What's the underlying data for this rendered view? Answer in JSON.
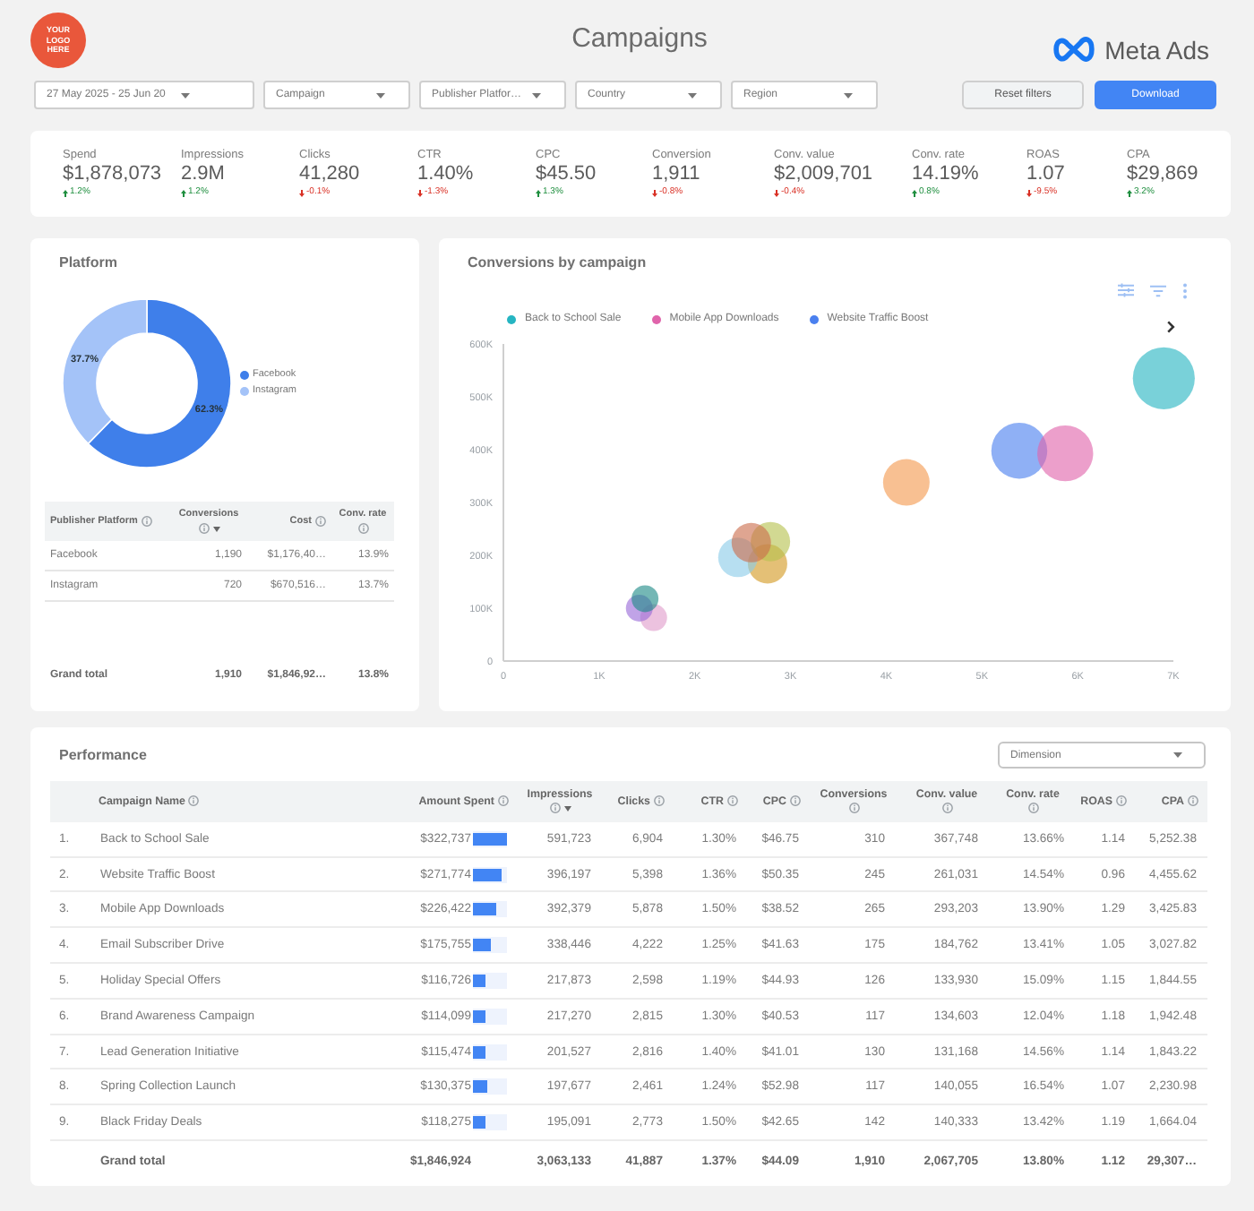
{
  "header": {
    "logo_text": "YOUR LOGO HERE",
    "title": "Campaigns",
    "brand": "Meta Ads"
  },
  "filters": [
    {
      "label": "27 May 2025 - 25 Jun 20"
    },
    {
      "label": "Campaign"
    },
    {
      "label": "Publisher Platfor…"
    },
    {
      "label": "Country"
    },
    {
      "label": "Region"
    }
  ],
  "buttons": [
    {
      "label": "Reset filters",
      "primary": false
    },
    {
      "label": "Download",
      "primary": true
    }
  ],
  "kpis": [
    {
      "label": "Spend",
      "value": "$1,878,073",
      "change": "1.2%",
      "up": true
    },
    {
      "label": "Impressions",
      "value": "2.9M",
      "change": "1.2%",
      "up": true
    },
    {
      "label": "Clicks",
      "value": "41,280",
      "change": "-0.1%",
      "up": false
    },
    {
      "label": "CTR",
      "value": "1.40%",
      "change": "-1.3%",
      "up": false
    },
    {
      "label": "CPC",
      "value": "$45.50",
      "change": "1.3%",
      "up": true
    },
    {
      "label": "Conversion",
      "value": "1,911",
      "change": "-0.8%",
      "up": false
    },
    {
      "label": "Conv. value",
      "value": "$2,009,701",
      "change": "-0.4%",
      "up": false
    },
    {
      "label": "Conv. rate",
      "value": "14.19%",
      "change": "0.8%",
      "up": true
    },
    {
      "label": "ROAS",
      "value": "1.07",
      "change": "-9.5%",
      "up": false
    },
    {
      "label": "CPA",
      "value": "$29,869",
      "change": "3.2%",
      "up": true
    }
  ],
  "platform": {
    "title": "Platform",
    "chart_data": {
      "type": "donut",
      "categories": [
        "Facebook",
        "Instagram"
      ],
      "values": [
        62.3,
        37.7
      ],
      "colors": [
        "#3f7fea",
        "#a4c3f8"
      ],
      "value_labels": [
        "62.3%",
        "37.7%"
      ]
    },
    "table": {
      "columns": [
        {
          "label": "Publisher Platform",
          "kind": "text",
          "help": true,
          "sorted": false
        },
        {
          "label": "Conversions",
          "kind": "number",
          "help": true,
          "sorted": true
        },
        {
          "label": "Cost",
          "kind": "number",
          "help": true,
          "sorted": false
        },
        {
          "label": "Conv. rate",
          "kind": "number",
          "help": true,
          "sorted": false
        }
      ],
      "rows": [
        {
          "cells": [
            "Facebook",
            "1,190",
            "$1,176,40…",
            "13.9%"
          ]
        },
        {
          "cells": [
            "Instagram",
            "720",
            "$670,516…",
            "13.7%"
          ]
        }
      ],
      "total": {
        "cells": [
          "Grand total",
          "1,910",
          "$1,846,92…",
          "13.8%"
        ]
      }
    }
  },
  "conversions_chart": {
    "title": "Conversions by campaign",
    "chart_data": {
      "type": "scatter",
      "xlim": [
        0,
        7000
      ],
      "ylim": [
        0,
        600000
      ],
      "xticks": [
        {
          "value": 0,
          "label": "0"
        },
        {
          "value": 1000,
          "label": "1K"
        },
        {
          "value": 2000,
          "label": "2K"
        },
        {
          "value": 3000,
          "label": "3K"
        },
        {
          "value": 4000,
          "label": "4K"
        },
        {
          "value": 5000,
          "label": "5K"
        },
        {
          "value": 6000,
          "label": "6K"
        },
        {
          "value": 7000,
          "label": "7K"
        }
      ],
      "yticks": [
        {
          "value": 0,
          "label": "0"
        },
        {
          "value": 100000,
          "label": "100K"
        },
        {
          "value": 200000,
          "label": "200K"
        },
        {
          "value": 300000,
          "label": "300K"
        },
        {
          "value": 400000,
          "label": "400K"
        },
        {
          "value": 500000,
          "label": "500K"
        },
        {
          "value": 600000,
          "label": "600K"
        }
      ],
      "series": [
        {
          "name": "Back to School Sale",
          "color": "#26b5c2",
          "x": [
            6900
          ],
          "values": [
            535000
          ]
        },
        {
          "name": "Mobile App Downloads",
          "color": "#e064ab",
          "x": [
            5870
          ],
          "values": [
            393000
          ]
        },
        {
          "name": "Website Traffic Boost",
          "color": "#4a80ef",
          "x": [
            5390
          ],
          "values": [
            398000
          ]
        },
        {
          "color": "#f39a4f",
          "x": [
            4210
          ],
          "values": [
            338000
          ]
        },
        {
          "color": "#cc6e4e",
          "x": [
            2590
          ],
          "values": [
            224000
          ]
        },
        {
          "color": "#b7c24f",
          "x": [
            2790
          ],
          "values": [
            226000
          ]
        },
        {
          "color": "#8acbe8",
          "x": [
            2450
          ],
          "values": [
            196000
          ]
        },
        {
          "color": "#d49a22",
          "x": [
            2760
          ],
          "values": [
            184000
          ]
        },
        {
          "color": "#1f8a88",
          "x": [
            1480
          ],
          "values": [
            118000
          ]
        },
        {
          "color": "#9a6ad9",
          "x": [
            1420
          ],
          "values": [
            100000
          ]
        },
        {
          "color": "#e19ccb",
          "x": [
            1570
          ],
          "values": [
            82000
          ]
        }
      ]
    }
  },
  "performance": {
    "title": "Performance",
    "dropdown": {
      "label": "Dimension"
    },
    "columns": [
      {
        "label": "Campaign Name",
        "kind": "text",
        "help": true,
        "sorted": false
      },
      {
        "label": "Amount Spent",
        "kind": "bar",
        "help": true,
        "sorted": false
      },
      {
        "label": "Impressions",
        "kind": "number",
        "help": true,
        "sorted": true
      },
      {
        "label": "Clicks",
        "kind": "number",
        "help": true,
        "sorted": false
      },
      {
        "label": "CTR",
        "kind": "number",
        "help": true,
        "sorted": false
      },
      {
        "label": "CPC",
        "kind": "number",
        "help": true,
        "sorted": false
      },
      {
        "label": "Conversions",
        "kind": "number",
        "help": true,
        "sorted": false
      },
      {
        "label": "Conv. value",
        "kind": "number",
        "help": true,
        "sorted": false
      },
      {
        "label": "Conv. rate",
        "kind": "number",
        "help": true,
        "sorted": false
      },
      {
        "label": "ROAS",
        "kind": "number",
        "help": true,
        "sorted": false
      },
      {
        "label": "CPA",
        "kind": "number",
        "help": true,
        "sorted": false
      }
    ],
    "rows": [
      {
        "rank": "1.",
        "cells": [
          "Back to School Sale",
          "$322,737",
          "591,723",
          "6,904",
          "1.30%",
          "$46.75",
          "310",
          "367,748",
          "13.66%",
          "1.14",
          "5,252.38"
        ],
        "level": 1
      },
      {
        "rank": "2.",
        "cells": [
          "Website Traffic Boost",
          "$271,774",
          "396,197",
          "5,398",
          "1.36%",
          "$50.35",
          "245",
          "261,031",
          "14.54%",
          "0.96",
          "4,455.62"
        ],
        "level": 0.84
      },
      {
        "rank": "3.",
        "cells": [
          "Mobile App Downloads",
          "$226,422",
          "392,379",
          "5,878",
          "1.50%",
          "$38.52",
          "265",
          "293,203",
          "13.90%",
          "1.29",
          "3,425.83"
        ],
        "level": 0.7
      },
      {
        "rank": "4.",
        "cells": [
          "Email Subscriber Drive",
          "$175,755",
          "338,446",
          "4,222",
          "1.25%",
          "$41.63",
          "175",
          "184,762",
          "13.41%",
          "1.05",
          "3,027.82"
        ],
        "level": 0.54
      },
      {
        "rank": "5.",
        "cells": [
          "Holiday Special Offers",
          "$116,726",
          "217,873",
          "2,598",
          "1.19%",
          "$44.93",
          "126",
          "133,930",
          "15.09%",
          "1.15",
          "1,844.55"
        ],
        "level": 0.36
      },
      {
        "rank": "6.",
        "cells": [
          "Brand Awareness Campaign",
          "$114,099",
          "217,270",
          "2,815",
          "1.30%",
          "$40.53",
          "117",
          "134,603",
          "12.04%",
          "1.18",
          "1,942.48"
        ],
        "level": 0.35
      },
      {
        "rank": "7.",
        "cells": [
          "Lead Generation Initiative",
          "$115,474",
          "201,527",
          "2,816",
          "1.40%",
          "$41.01",
          "130",
          "131,168",
          "14.56%",
          "1.14",
          "1,843.22"
        ],
        "level": 0.36
      },
      {
        "rank": "8.",
        "cells": [
          "Spring Collection Launch",
          "$130,375",
          "197,677",
          "2,461",
          "1.24%",
          "$52.98",
          "117",
          "140,055",
          "16.54%",
          "1.07",
          "2,230.98"
        ],
        "level": 0.4
      },
      {
        "rank": "9.",
        "cells": [
          "Black Friday Deals",
          "$118,275",
          "195,091",
          "2,773",
          "1.50%",
          "$42.65",
          "142",
          "140,333",
          "13.42%",
          "1.19",
          "1,664.04"
        ],
        "level": 0.37
      }
    ],
    "total": {
      "cells": [
        "Grand total",
        "$1,846,924",
        "3,063,133",
        "41,887",
        "1.37%",
        "$44.09",
        "1,910",
        "2,067,705",
        "13.80%",
        "1.12",
        "29,307…"
      ]
    }
  }
}
